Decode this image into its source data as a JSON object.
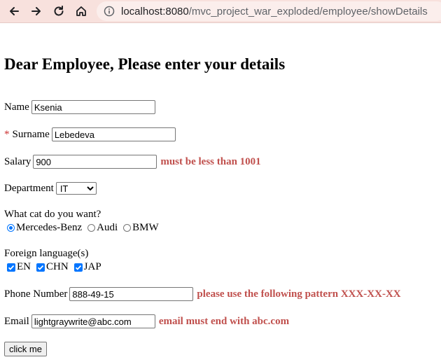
{
  "browser": {
    "url_host": "localhost:8080",
    "url_path": "/mvc_project_war_exploded/employee/showDetails"
  },
  "page": {
    "title": "Dear Employee, Please enter your details"
  },
  "form": {
    "name": {
      "label": "Name",
      "value": "Ksenia"
    },
    "surname": {
      "required_mark": "*",
      "label": "Surname",
      "value": "Lebedeva"
    },
    "salary": {
      "label": "Salary",
      "value": "900",
      "error": "must be less than 1001"
    },
    "department": {
      "label": "Department",
      "selected": "IT"
    },
    "car": {
      "question": "What cat do you want?",
      "options": [
        {
          "label": "Mercedes-Benz",
          "checked": true
        },
        {
          "label": "Audi",
          "checked": false
        },
        {
          "label": "BMW",
          "checked": false
        }
      ]
    },
    "languages": {
      "label": "Foreign language(s)",
      "options": [
        {
          "label": "EN",
          "checked": true
        },
        {
          "label": "CHN",
          "checked": true
        },
        {
          "label": "JAP",
          "checked": true
        }
      ]
    },
    "phone": {
      "label": "Phone Number",
      "value": "888-49-15",
      "error": "please use the following pattern XXX-XX-XX"
    },
    "email": {
      "label": "Email",
      "value": "lightgraywrite@abc.com",
      "error": "email must end with abc.com"
    },
    "submit_label": "click me"
  },
  "colors": {
    "error": "#c0504d",
    "toolbar": "#f8e1dd",
    "accent": "#0075ff"
  }
}
